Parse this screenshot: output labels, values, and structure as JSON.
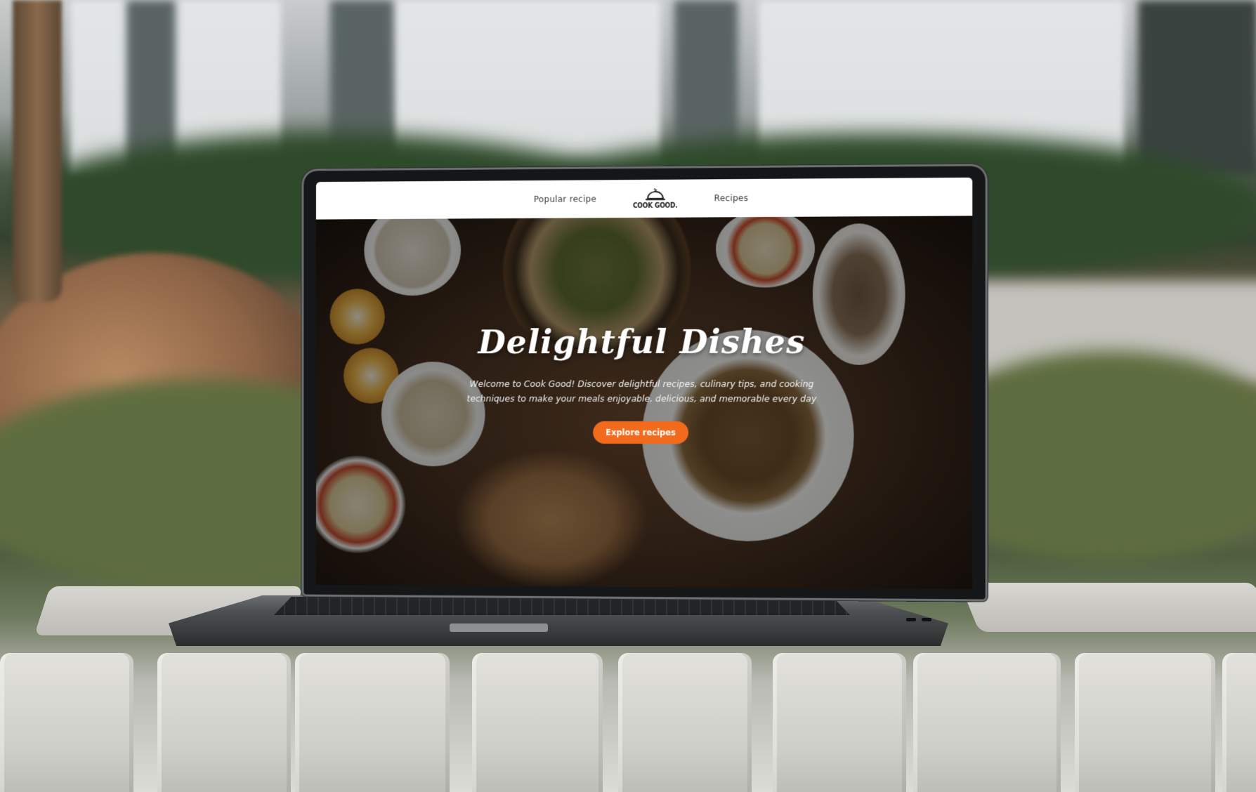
{
  "nav": {
    "left_link": "Popular recipe",
    "right_link": "Recipes",
    "logo_text": "COOK GOOD.",
    "logo_icon": "cloche-icon"
  },
  "hero": {
    "title": "Delightful Dishes",
    "subtitle": "Welcome to Cook Good! Discover delightful recipes, culinary tips, and cooking techniques to make your meals enjoyable, delicious, and memorable every day",
    "button_label": "Explore recipes"
  },
  "colors": {
    "accent": "#f26b1d",
    "nav_bg": "#ffffff",
    "nav_text": "#3a3a3a"
  }
}
